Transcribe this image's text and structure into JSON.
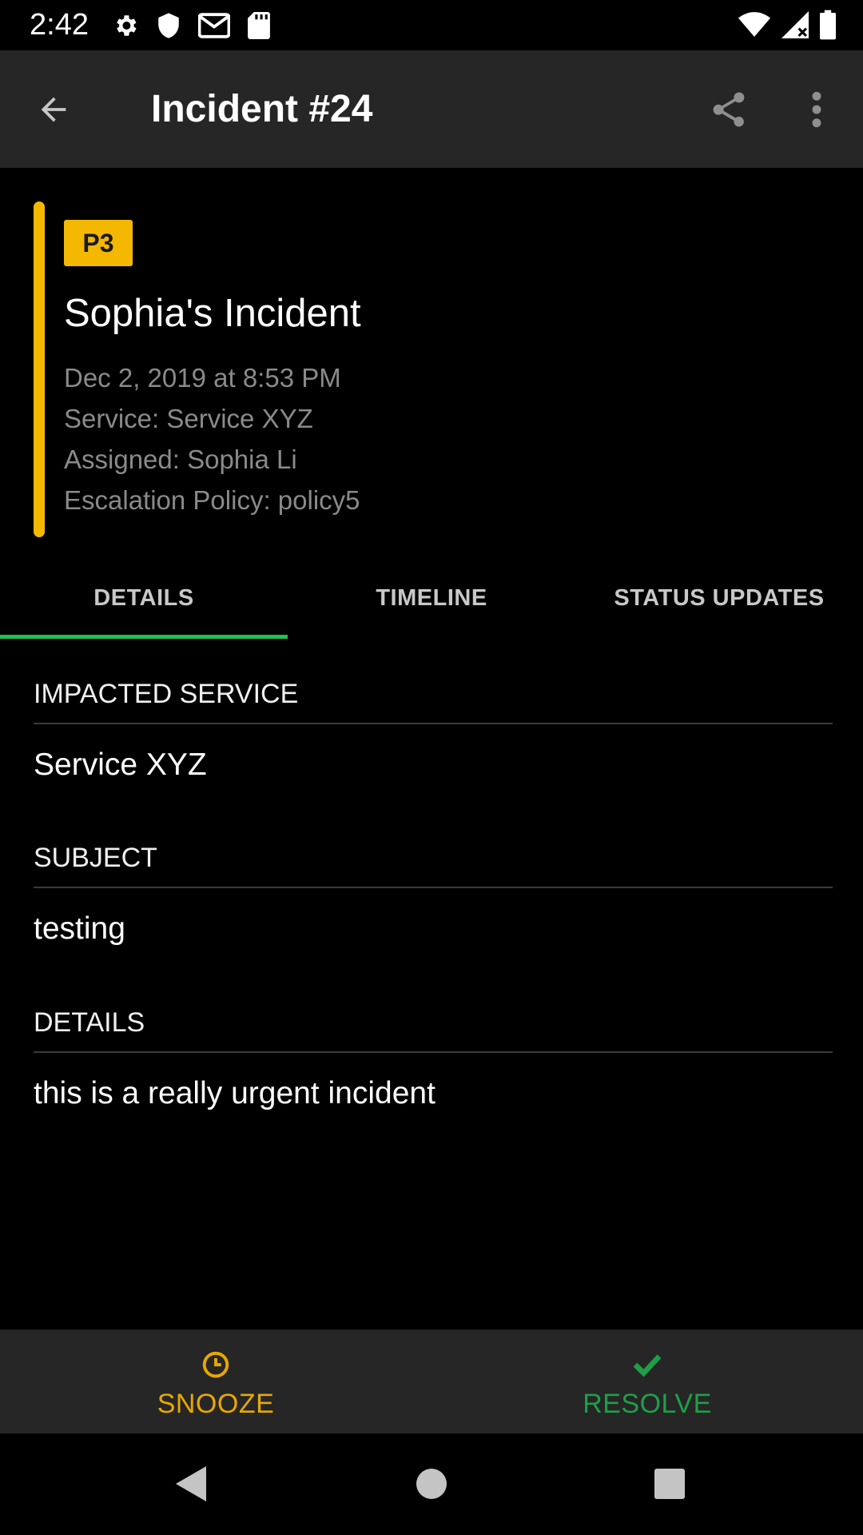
{
  "status_bar": {
    "time": "2:42",
    "left_icons": [
      "gear-icon",
      "shield-icon",
      "gmail-icon",
      "sd-card-icon"
    ],
    "right_icons": [
      "wifi-icon",
      "signal-icon",
      "battery-icon"
    ]
  },
  "app_bar": {
    "title": "Incident #24",
    "back_icon": "arrow-back-icon",
    "share_icon": "share-icon",
    "more_icon": "more-vert-icon"
  },
  "incident": {
    "priority": "P3",
    "priority_color": "#f5b800",
    "name": "Sophia's Incident",
    "datetime": "Dec 2, 2019 at 8:53 PM",
    "service": "Service: Service XYZ",
    "assigned": "Assigned: Sophia Li",
    "escalation_policy": "Escalation Policy: policy5"
  },
  "tabs": {
    "active": "DETAILS",
    "indicator_color": "#25c151",
    "items": [
      {
        "label": "DETAILS"
      },
      {
        "label": "TIMELINE"
      },
      {
        "label": "STATUS UPDATES"
      }
    ]
  },
  "details": {
    "sections": [
      {
        "label": "IMPACTED SERVICE",
        "value": "Service XYZ"
      },
      {
        "label": "SUBJECT",
        "value": "testing"
      },
      {
        "label": "DETAILS",
        "value": "this is a really urgent incident"
      }
    ]
  },
  "actions": {
    "snooze": {
      "label": "SNOOZE",
      "icon": "clock-icon",
      "color": "#e8a800"
    },
    "resolve": {
      "label": "RESOLVE",
      "icon": "check-icon",
      "color": "#1f9e47"
    }
  },
  "nav_bar": {
    "icons": [
      "nav-back-icon",
      "nav-home-icon",
      "nav-recents-icon"
    ]
  }
}
